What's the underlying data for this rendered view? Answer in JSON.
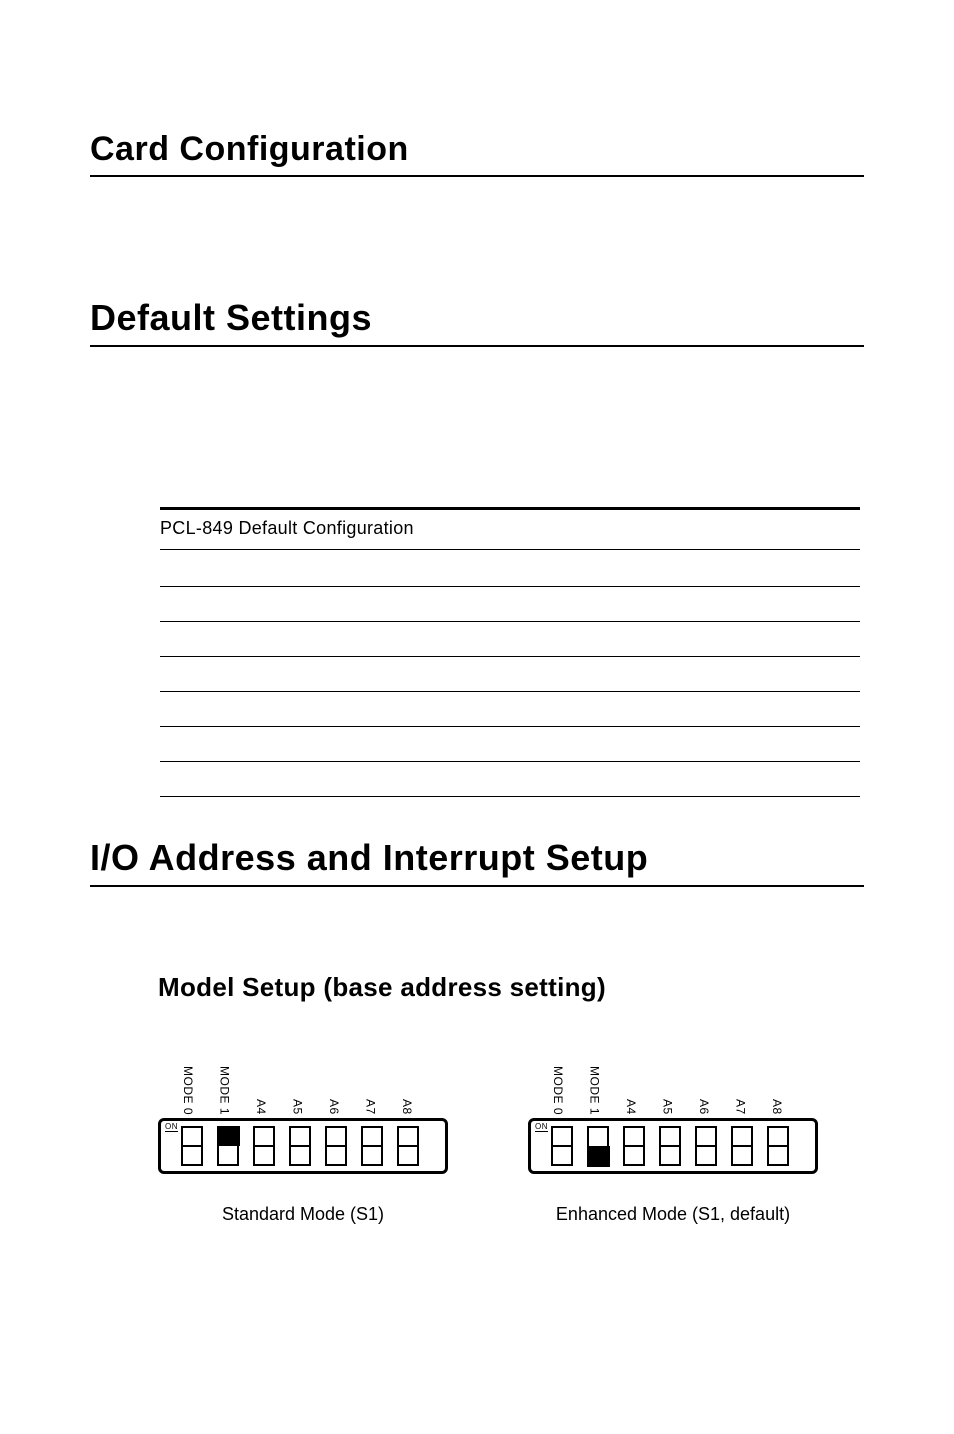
{
  "headings": {
    "chapter": "Card Configuration",
    "section1": "Default Settings",
    "tableTitle": "PCL-849  Default Configuration",
    "section2": "I/O Address and Interrupt Setup",
    "subsection": "Model Setup (base address setting)"
  },
  "dip": {
    "labels": [
      "MODE 0",
      "MODE 1",
      "A4",
      "A5",
      "A6",
      "A7",
      "A8"
    ],
    "onText": "ON",
    "standard": {
      "caption": "Standard Mode (S1)",
      "positions": [
        "down",
        "up",
        "down",
        "down",
        "down",
        "down",
        "down"
      ]
    },
    "enhanced": {
      "caption": "Enhanced Mode (S1, default)",
      "positions": [
        "down",
        "down",
        "down",
        "down",
        "down",
        "down",
        "down"
      ],
      "filled": [
        false,
        true,
        false,
        false,
        false,
        false,
        false
      ]
    }
  }
}
